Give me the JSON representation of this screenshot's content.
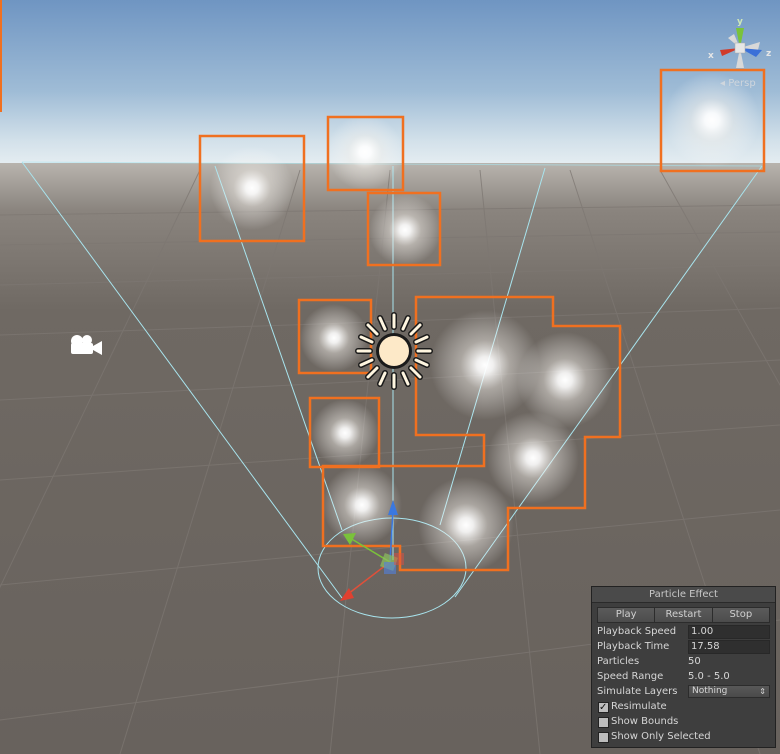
{
  "viewport": {
    "projection_label": "Persp",
    "gizmo_axes": {
      "x": "x",
      "y": "y",
      "z": "z"
    },
    "colors": {
      "sky_top": "#7aa0c8",
      "horizon": "#dde8ee",
      "ground": "#6b6560",
      "selection_outline": "#f07020",
      "cone_lines": "#a8e4ee"
    },
    "icons": [
      "camera-icon",
      "directional-light-icon",
      "scene-gizmo-icon",
      "transform-gizmo-icon"
    ]
  },
  "particle_panel": {
    "title": "Particle Effect",
    "buttons": {
      "play": "Play",
      "restart": "Restart",
      "stop": "Stop"
    },
    "rows": {
      "playback_speed": {
        "label": "Playback Speed",
        "value": "1.00"
      },
      "playback_time": {
        "label": "Playback Time",
        "value": "17.58"
      },
      "particles": {
        "label": "Particles",
        "value": "50"
      },
      "speed_range": {
        "label": "Speed Range",
        "value": "5.0 - 5.0"
      },
      "simulate_layers": {
        "label": "Simulate Layers",
        "value": "Nothing"
      }
    },
    "toggles": {
      "resimulate": {
        "label": "Resimulate",
        "checked": true
      },
      "show_bounds": {
        "label": "Show Bounds",
        "checked": false
      },
      "show_only_selected": {
        "label": "Show Only Selected",
        "checked": false
      }
    }
  }
}
